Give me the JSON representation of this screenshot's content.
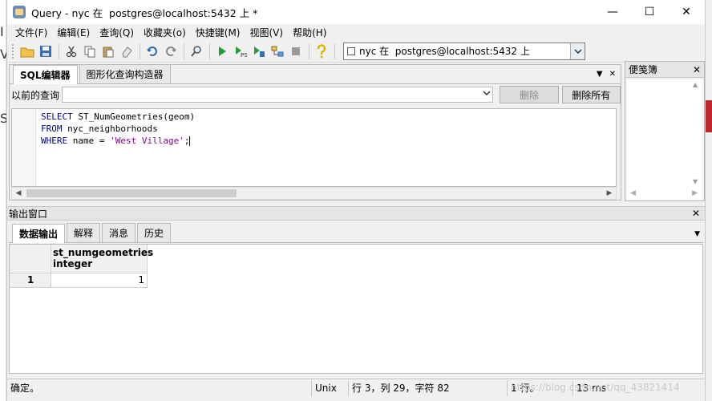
{
  "window": {
    "title": "Query - nyc 在  postgres@localhost:5432 上 *",
    "minimize": "—",
    "maximize": "☐",
    "close": "✕"
  },
  "menubar": [
    {
      "label": "文件(F)"
    },
    {
      "label": "编辑(E)"
    },
    {
      "label": "查询(Q)"
    },
    {
      "label": "收藏夹(o)"
    },
    {
      "label": "快捷键(M)"
    },
    {
      "label": "视图(V)"
    },
    {
      "label": "帮助(H)"
    }
  ],
  "toolbar": {
    "connection": "nyc 在  postgres@localhost:5432 上"
  },
  "editor": {
    "tabs": [
      {
        "label": "SQL编辑器",
        "active": true
      },
      {
        "label": "图形化查询构造器",
        "active": false
      }
    ],
    "previous_label": "以前的查询",
    "delete_label": "删除",
    "delete_all_label": "删除所有",
    "code": {
      "line1_kw": "SELECT",
      "line1_rest": " ST_NumGeometries(geom)",
      "line2_kw": "FROM",
      "line2_rest": " nyc_neighborhoods",
      "line3_kw": "WHERE",
      "line3_mid": " name = ",
      "line3_str": "'West Village'",
      "line3_end": ";"
    }
  },
  "scratch": {
    "title": "便笺簿"
  },
  "output": {
    "title": "输出窗口",
    "tabs": [
      {
        "label": "数据输出",
        "active": true
      },
      {
        "label": "解释",
        "active": false
      },
      {
        "label": "消息",
        "active": false
      },
      {
        "label": "历史",
        "active": false
      }
    ],
    "column_name": "st_numgeometries",
    "column_type": "integer",
    "row_number": "1",
    "value": "1"
  },
  "status": {
    "message": "确定。",
    "line_ending": "Unix",
    "position": "行 3，列 29，字符 82",
    "rows": "1 行。",
    "time": "13 ms"
  },
  "watermark": "https://blog.csdn.net/qq_43821414"
}
